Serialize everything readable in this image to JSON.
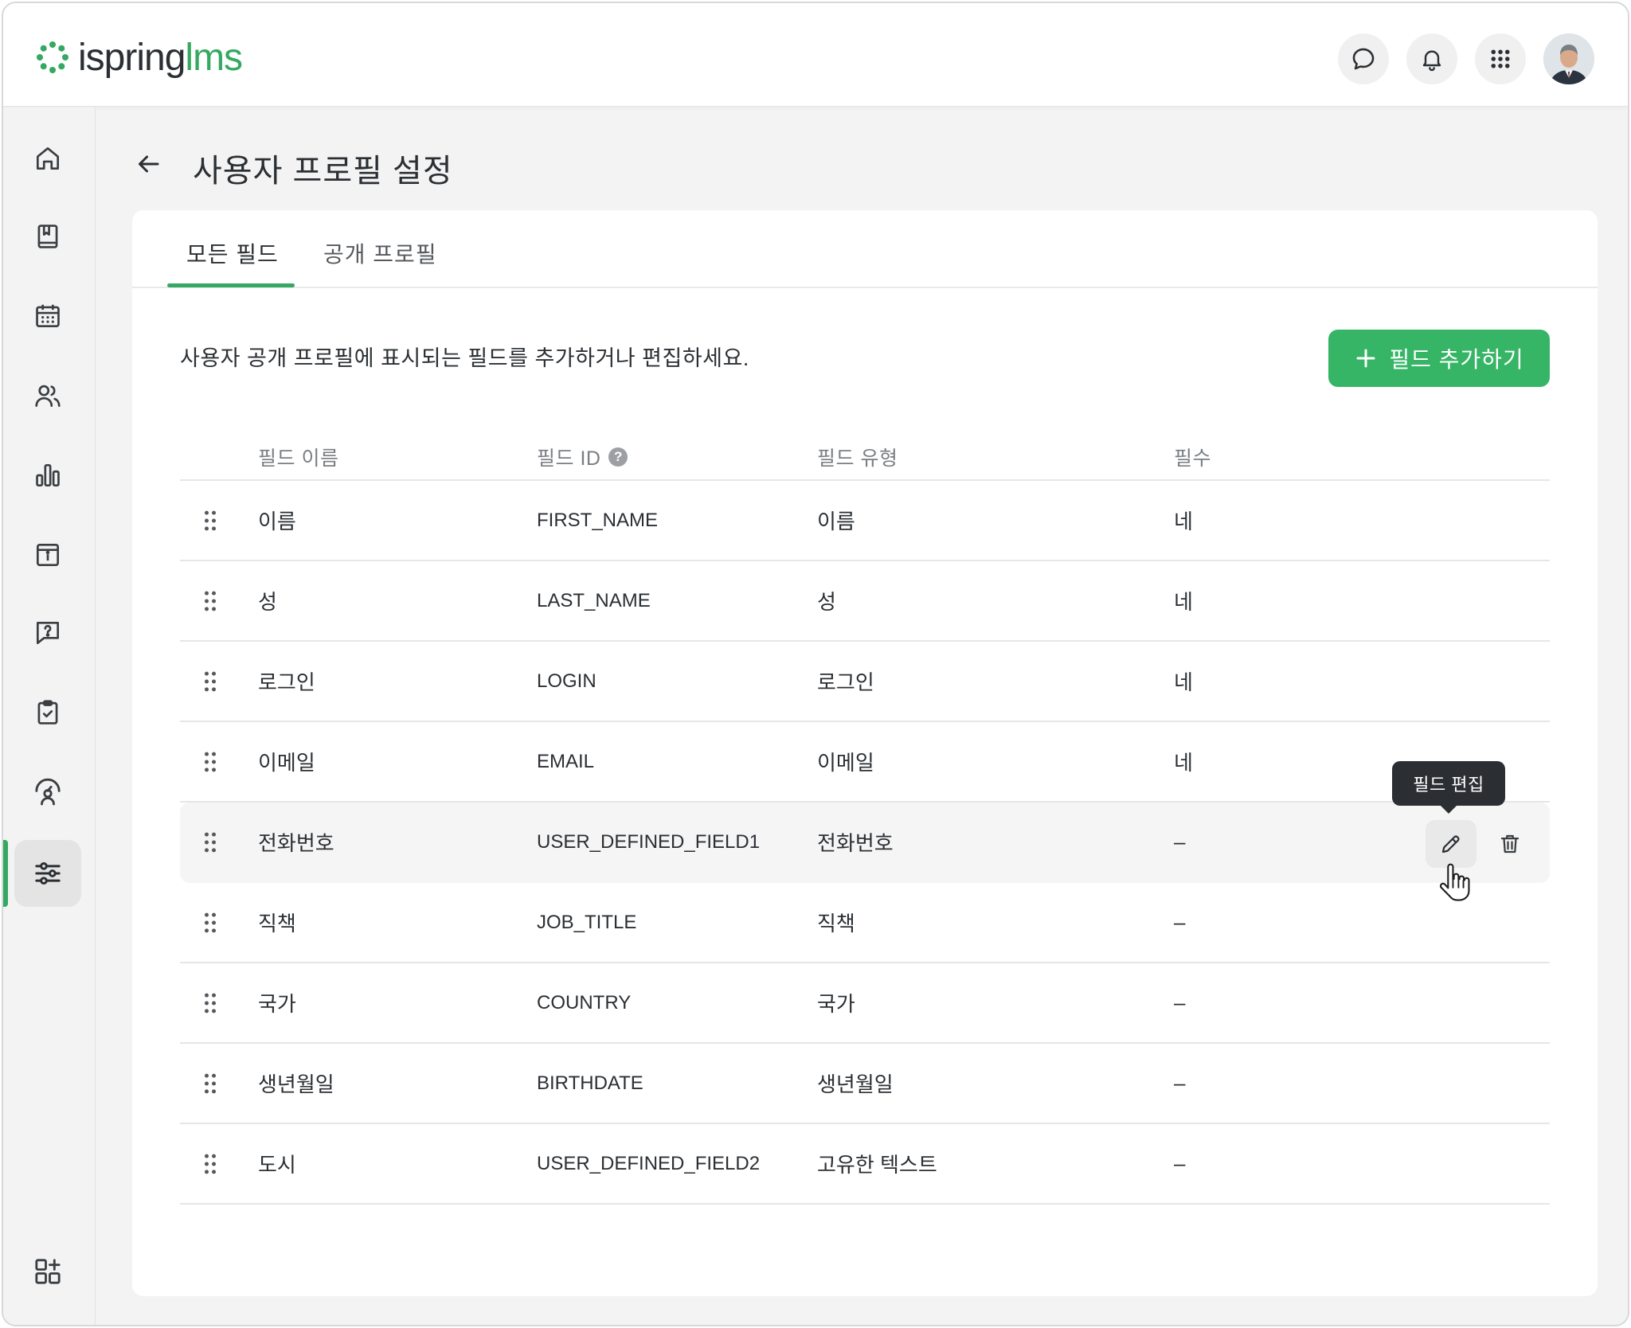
{
  "app": {
    "logo_text_1": "ispring",
    "logo_text_2": "lms",
    "brand_color": "#35a862"
  },
  "topbar": {
    "icons": [
      "chat-icon",
      "bell-icon",
      "apps-grid-icon"
    ]
  },
  "sidebar": {
    "items": [
      {
        "icon": "home-icon"
      },
      {
        "icon": "book-icon"
      },
      {
        "icon": "calendar-icon"
      },
      {
        "icon": "users-icon"
      },
      {
        "icon": "bar-chart-icon"
      },
      {
        "icon": "info-panel-icon"
      },
      {
        "icon": "help-chat-icon"
      },
      {
        "icon": "clipboard-check-icon"
      },
      {
        "icon": "user-gauge-icon"
      },
      {
        "icon": "sliders-icon",
        "active": true
      }
    ],
    "bottom_icon": "add-widget-icon"
  },
  "page": {
    "title": "사용자 프로필 설정"
  },
  "tabs": [
    {
      "label": "모든 필드",
      "active": true
    },
    {
      "label": "공개 프로필",
      "active": false
    }
  ],
  "description": "사용자 공개 프로필에 표시되는 필드를 추가하거나 편집하세요.",
  "add_button": {
    "label": "필드 추가하기"
  },
  "table": {
    "headers": {
      "name": "필드 이름",
      "id": "필드 ID",
      "type": "필드 유형",
      "required": "필수"
    },
    "rows": [
      {
        "name": "이름",
        "id": "FIRST_NAME",
        "type": "이름",
        "required": "네"
      },
      {
        "name": "성",
        "id": "LAST_NAME",
        "type": "성",
        "required": "네"
      },
      {
        "name": "로그인",
        "id": "LOGIN",
        "type": "로그인",
        "required": "네"
      },
      {
        "name": "이메일",
        "id": "EMAIL",
        "type": "이메일",
        "required": "네"
      },
      {
        "name": "전화번호",
        "id": "USER_DEFINED_FIELD1",
        "type": "전화번호",
        "required": "–"
      },
      {
        "name": "직책",
        "id": "JOB_TITLE",
        "type": "직책",
        "required": "–"
      },
      {
        "name": "국가",
        "id": "COUNTRY",
        "type": "국가",
        "required": "–"
      },
      {
        "name": "생년월일",
        "id": "BIRTHDATE",
        "type": "생년월일",
        "required": "–"
      },
      {
        "name": "도시",
        "id": "USER_DEFINED_FIELD2",
        "type": "고유한 텍스트",
        "required": "–"
      }
    ]
  },
  "tooltip": {
    "text": "필드 편집"
  }
}
